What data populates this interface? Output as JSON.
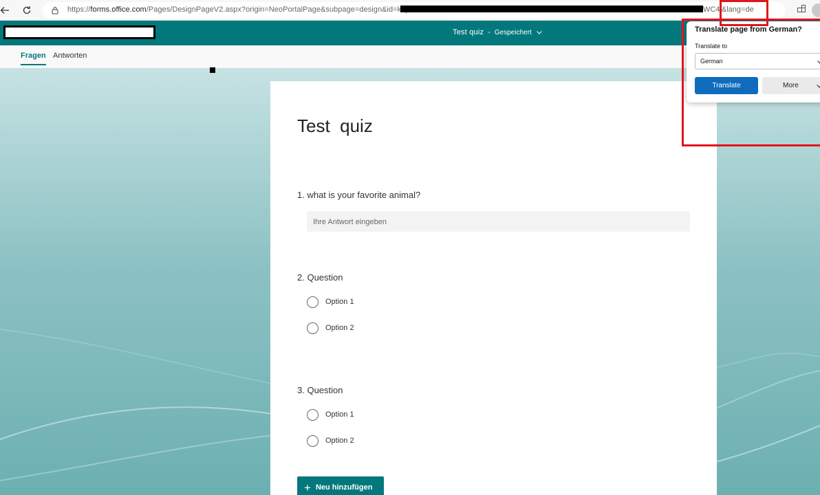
{
  "browser": {
    "url_scheme": "https://",
    "url_host": "forms.office.com",
    "url_path": "/Pages/DesignPageV2.aspx?origin=NeoPortalPage&subpage=design&id=kap5",
    "url_tail": "WC4i&lang=de"
  },
  "header": {
    "form_title": "Test  quiz",
    "separator": "-",
    "save_status": "Gespeichert"
  },
  "tabs": [
    {
      "label": "Fragen",
      "active": true
    },
    {
      "label": "Antworten",
      "active": false
    }
  ],
  "form": {
    "title": "Test  quiz",
    "questions": [
      {
        "title": "1. what is your favorite animal?",
        "type": "text",
        "placeholder": "Ihre Antwort eingeben"
      },
      {
        "title": "2. Question",
        "type": "choice",
        "options": [
          "Option 1",
          "Option 2"
        ]
      },
      {
        "title": "3. Question",
        "type": "choice",
        "options": [
          "Option 1",
          "Option 2"
        ]
      }
    ],
    "add_button_label": "Neu hinzufügen"
  },
  "translate_popup": {
    "title": "Translate page from German?",
    "translate_to_label": "Translate to",
    "selected_language": "German",
    "translate_button": "Translate",
    "more_button": "More"
  },
  "colors": {
    "brand": "#03787c",
    "highlight": "#e3141c",
    "translate_button": "#0f6cbd"
  }
}
